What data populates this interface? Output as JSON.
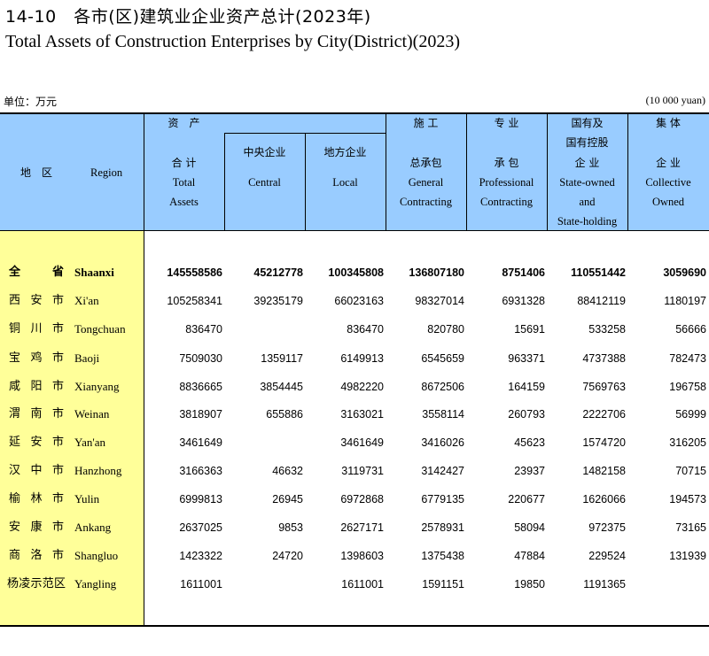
{
  "title": {
    "cn": "14-10　各市(区)建筑业企业资产总计(2023年)",
    "en": "Total Assets of Construction Enterprises by City(District)(2023)"
  },
  "unit": {
    "cn": "单位：万元",
    "en": "(10 000 yuan)"
  },
  "headers": {
    "region": {
      "cn": "地　区",
      "en": "Region"
    },
    "assets_group": "资　产",
    "total": {
      "cn": "合 计",
      "en1": "Total",
      "en2": "Assets"
    },
    "central": {
      "cn": "中央企业",
      "en": "Central"
    },
    "local": {
      "cn": "地方企业",
      "en": "Local"
    },
    "general": {
      "cn1": "施 工",
      "cn2": "总承包",
      "en1": "General",
      "en2": "Contracting"
    },
    "professional": {
      "cn1": "专 业",
      "cn2": "承 包",
      "en1": "Professional",
      "en2": "Contracting"
    },
    "state": {
      "cn1": "国有及",
      "cn2": "国有控股",
      "cn3": "企 业",
      "en1": "State-owned",
      "en2": "and",
      "en3": "State-holding"
    },
    "collective": {
      "cn1": "集 体",
      "cn2": "企 业",
      "en1": "Collective",
      "en2": "Owned"
    }
  },
  "rows": [
    {
      "cn": "全省",
      "en": "Shaanxi",
      "total": "145558586",
      "central": "45212778",
      "local": "100345808",
      "general": "136807180",
      "professional": "8751406",
      "state": "110551442",
      "collective": "3059690"
    },
    {
      "cn": "西安市",
      "en": "Xi'an",
      "total": "105258341",
      "central": "39235179",
      "local": "66023163",
      "general": "98327014",
      "professional": "6931328",
      "state": "88412119",
      "collective": "1180197"
    },
    {
      "cn": "铜川市",
      "en": "Tongchuan",
      "total": "836470",
      "central": "",
      "local": "836470",
      "general": "820780",
      "professional": "15691",
      "state": "533258",
      "collective": "56666"
    },
    {
      "cn": "宝鸡市",
      "en": "Baoji",
      "total": "7509030",
      "central": "1359117",
      "local": "6149913",
      "general": "6545659",
      "professional": "963371",
      "state": "4737388",
      "collective": "782473"
    },
    {
      "cn": "咸阳市",
      "en": "Xianyang",
      "total": "8836665",
      "central": "3854445",
      "local": "4982220",
      "general": "8672506",
      "professional": "164159",
      "state": "7569763",
      "collective": "196758"
    },
    {
      "cn": "渭南市",
      "en": "Weinan",
      "total": "3818907",
      "central": "655886",
      "local": "3163021",
      "general": "3558114",
      "professional": "260793",
      "state": "2222706",
      "collective": "56999"
    },
    {
      "cn": "延安市",
      "en": "Yan'an",
      "total": "3461649",
      "central": "",
      "local": "3461649",
      "general": "3416026",
      "professional": "45623",
      "state": "1574720",
      "collective": "316205"
    },
    {
      "cn": "汉中市",
      "en": "Hanzhong",
      "total": "3166363",
      "central": "46632",
      "local": "3119731",
      "general": "3142427",
      "professional": "23937",
      "state": "1482158",
      "collective": "70715"
    },
    {
      "cn": "榆林市",
      "en": "Yulin",
      "total": "6999813",
      "central": "26945",
      "local": "6972868",
      "general": "6779135",
      "professional": "220677",
      "state": "1626066",
      "collective": "194573"
    },
    {
      "cn": "安康市",
      "en": "Ankang",
      "total": "2637025",
      "central": "9853",
      "local": "2627171",
      "general": "2578931",
      "professional": "58094",
      "state": "972375",
      "collective": "73165"
    },
    {
      "cn": "商洛市",
      "en": "Shangluo",
      "total": "1423322",
      "central": "24720",
      "local": "1398603",
      "general": "1375438",
      "professional": "47884",
      "state": "229524",
      "collective": "131939"
    },
    {
      "cn": "杨凌示范区",
      "en": "Yangling",
      "total": "1611001",
      "central": "",
      "local": "1611001",
      "general": "1591151",
      "professional": "19850",
      "state": "1191365",
      "collective": ""
    }
  ]
}
